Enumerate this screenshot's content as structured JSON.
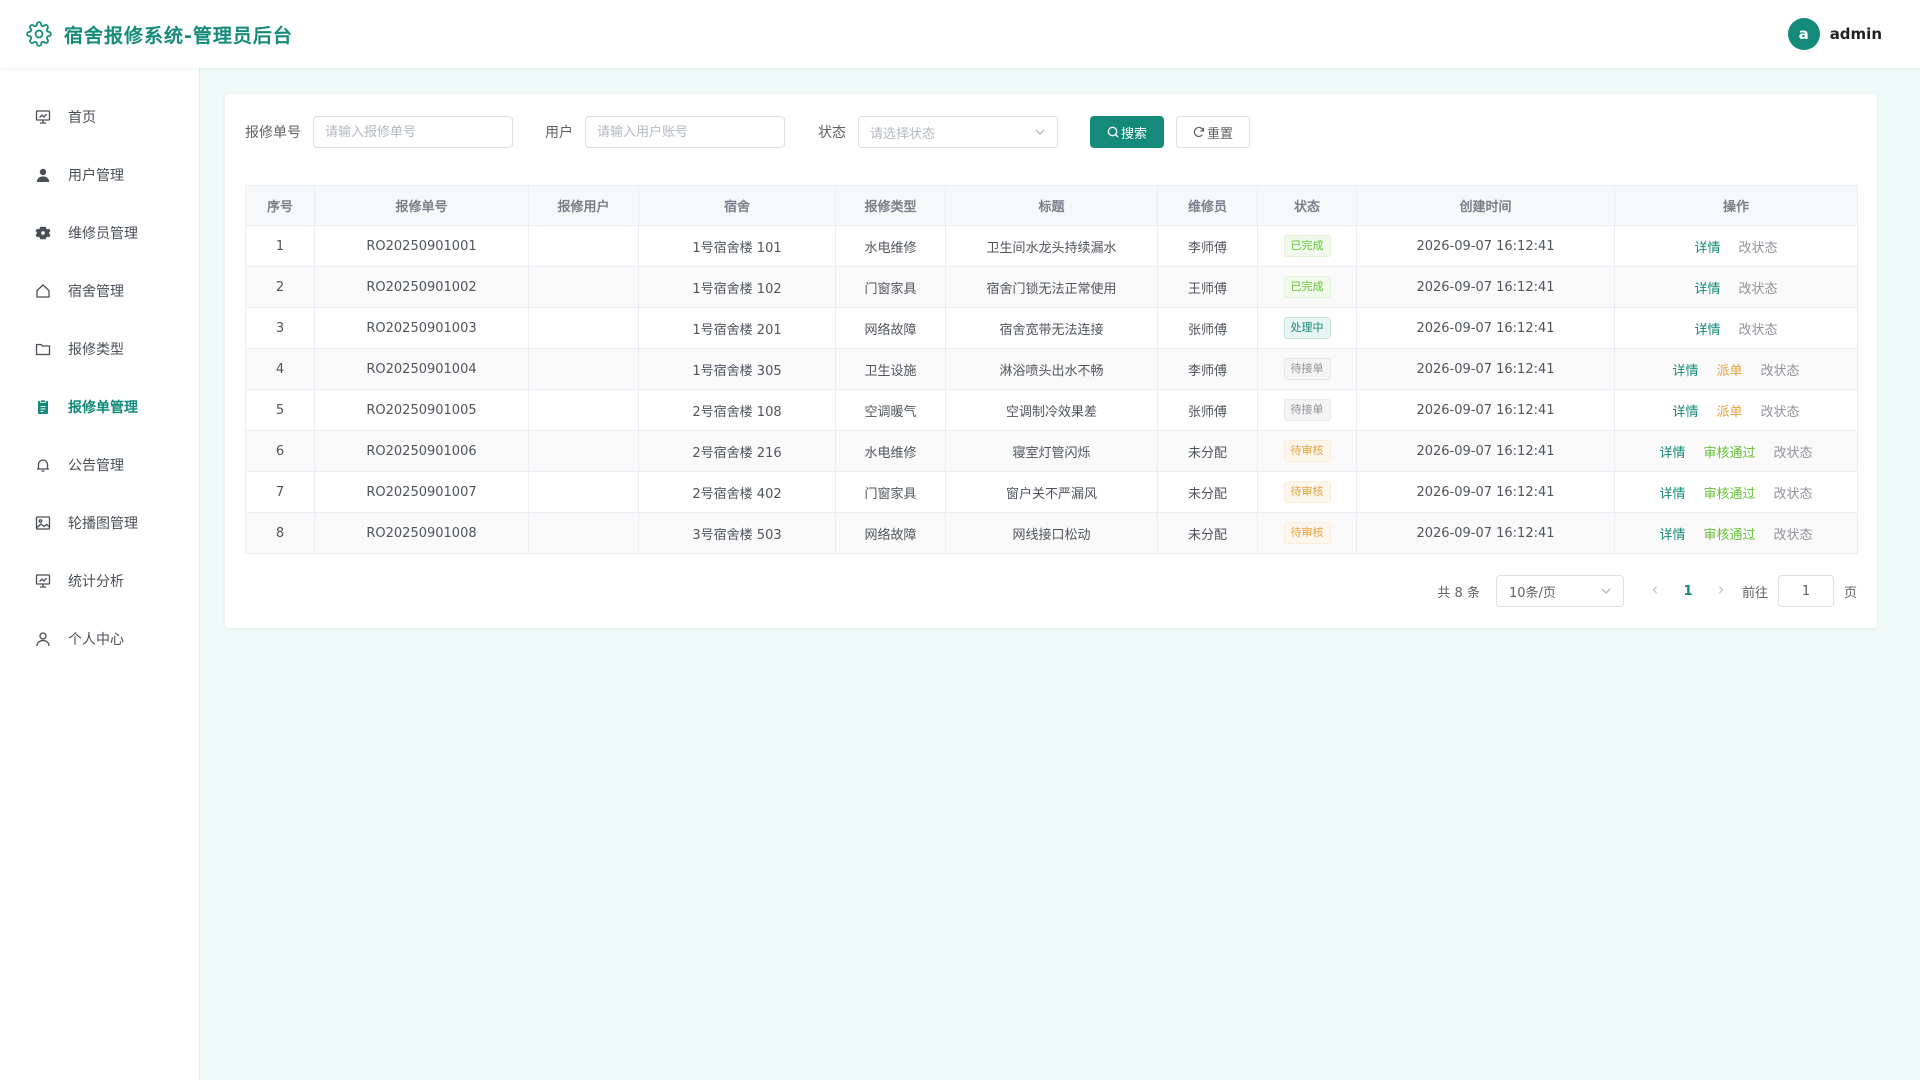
{
  "header": {
    "title": "宿舍报修系统-管理员后台",
    "avatar_letter": "a",
    "username": "admin"
  },
  "sidebar": {
    "items": [
      {
        "label": "首页",
        "icon": "dashboard-icon"
      },
      {
        "label": "用户管理",
        "icon": "user-icon"
      },
      {
        "label": "维修员管理",
        "icon": "gear-icon"
      },
      {
        "label": "宿舍管理",
        "icon": "house-icon"
      },
      {
        "label": "报修类型",
        "icon": "folder-icon"
      },
      {
        "label": "报修单管理",
        "icon": "document-icon"
      },
      {
        "label": "公告管理",
        "icon": "bell-icon"
      },
      {
        "label": "轮播图管理",
        "icon": "picture-icon"
      },
      {
        "label": "统计分析",
        "icon": "chart-icon"
      },
      {
        "label": "个人中心",
        "icon": "person-icon"
      }
    ],
    "active_index": 5
  },
  "filters": {
    "order_label": "报修单号",
    "order_placeholder": "请输入报修单号",
    "user_label": "用户",
    "user_placeholder": "请输入用户账号",
    "status_label": "状态",
    "status_placeholder": "请选择状态",
    "search_label": "搜索",
    "reset_label": "重置"
  },
  "table": {
    "columns": [
      "序号",
      "报修单号",
      "报修用户",
      "宿舍",
      "报修类型",
      "标题",
      "维修员",
      "状态",
      "创建时间",
      "操作"
    ],
    "rows": [
      {
        "index": "1",
        "order_no": "RO20250901001",
        "user": "",
        "dorm": "1号宿舍楼 101",
        "type": "水电维修",
        "title": "卫生间水龙头持续漏水",
        "repairer": "李师傅",
        "status": "已完成",
        "created": "2026-09-07 16:12:41",
        "actions": [
          "详情",
          "改状态"
        ]
      },
      {
        "index": "2",
        "order_no": "RO20250901002",
        "user": "",
        "dorm": "1号宿舍楼 102",
        "type": "门窗家具",
        "title": "宿舍门锁无法正常使用",
        "repairer": "王师傅",
        "status": "已完成",
        "created": "2026-09-07 16:12:41",
        "actions": [
          "详情",
          "改状态"
        ]
      },
      {
        "index": "3",
        "order_no": "RO20250901003",
        "user": "",
        "dorm": "1号宿舍楼 201",
        "type": "网络故障",
        "title": "宿舍宽带无法连接",
        "repairer": "张师傅",
        "status": "处理中",
        "created": "2026-09-07 16:12:41",
        "actions": [
          "详情",
          "改状态"
        ]
      },
      {
        "index": "4",
        "order_no": "RO20250901004",
        "user": "",
        "dorm": "1号宿舍楼 305",
        "type": "卫生设施",
        "title": "淋浴喷头出水不畅",
        "repairer": "李师傅",
        "status": "待接单",
        "created": "2026-09-07 16:12:41",
        "actions": [
          "详情",
          "派单",
          "改状态"
        ]
      },
      {
        "index": "5",
        "order_no": "RO20250901005",
        "user": "",
        "dorm": "2号宿舍楼 108",
        "type": "空调暖气",
        "title": "空调制冷效果差",
        "repairer": "张师傅",
        "status": "待接单",
        "created": "2026-09-07 16:12:41",
        "actions": [
          "详情",
          "派单",
          "改状态"
        ]
      },
      {
        "index": "6",
        "order_no": "RO20250901006",
        "user": "",
        "dorm": "2号宿舍楼 216",
        "type": "水电维修",
        "title": "寝室灯管闪烁",
        "repairer": "未分配",
        "status": "待审核",
        "created": "2026-09-07 16:12:41",
        "actions": [
          "详情",
          "审核通过",
          "改状态"
        ]
      },
      {
        "index": "7",
        "order_no": "RO20250901007",
        "user": "",
        "dorm": "2号宿舍楼 402",
        "type": "门窗家具",
        "title": "窗户关不严漏风",
        "repairer": "未分配",
        "status": "待审核",
        "created": "2026-09-07 16:12:41",
        "actions": [
          "详情",
          "审核通过",
          "改状态"
        ]
      },
      {
        "index": "8",
        "order_no": "RO20250901008",
        "user": "",
        "dorm": "3号宿舍楼 503",
        "type": "网络故障",
        "title": "网线接口松动",
        "repairer": "未分配",
        "status": "待审核",
        "created": "2026-09-07 16:12:41",
        "actions": [
          "详情",
          "审核通过",
          "改状态"
        ]
      }
    ]
  },
  "pagination": {
    "total_text": "共 8 条",
    "page_size": "10条/页",
    "current_page": "1",
    "goto_label": "前往",
    "goto_value": "1",
    "page_suffix": "页"
  },
  "colors": {
    "accent": "#138a7a",
    "success": "#67c23a",
    "warning": "#e6a23c",
    "muted": "#909399"
  }
}
